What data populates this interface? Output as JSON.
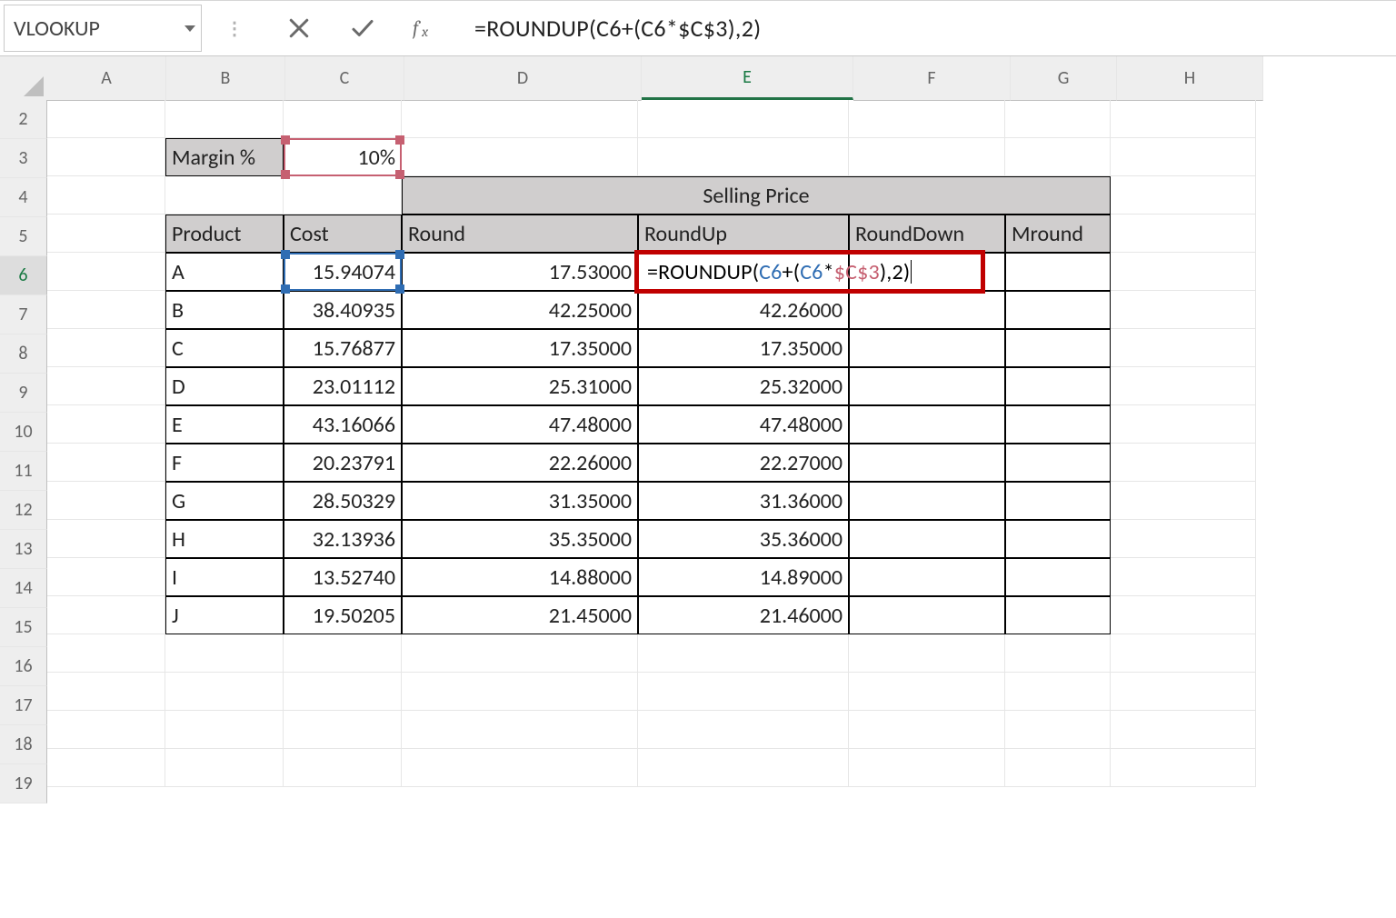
{
  "formula_bar": {
    "name_box": "VLOOKUP",
    "formula": "=ROUNDUP(C6+(C6*$C$3),2)"
  },
  "columns": [
    "A",
    "B",
    "C",
    "D",
    "E",
    "F",
    "G",
    "H"
  ],
  "active_column": "E",
  "row_start": 2,
  "row_end": 19,
  "active_row": 6,
  "margin": {
    "label": "Margin %",
    "value": "10%"
  },
  "section_header": "Selling Price",
  "table_headers": {
    "product": "Product",
    "cost": "Cost",
    "round": "Round",
    "roundup": "RoundUp",
    "rounddown": "RoundDown",
    "mround": "Mround"
  },
  "products": [
    {
      "name": "A",
      "cost": "15.94074",
      "round": "17.53000",
      "roundup": "",
      "rounddown": "",
      "mround": ""
    },
    {
      "name": "B",
      "cost": "38.40935",
      "round": "42.25000",
      "roundup": "42.26000",
      "rounddown": "",
      "mround": ""
    },
    {
      "name": "C",
      "cost": "15.76877",
      "round": "17.35000",
      "roundup": "17.35000",
      "rounddown": "",
      "mround": ""
    },
    {
      "name": "D",
      "cost": "23.01112",
      "round": "25.31000",
      "roundup": "25.32000",
      "rounddown": "",
      "mround": ""
    },
    {
      "name": "E",
      "cost": "43.16066",
      "round": "47.48000",
      "roundup": "47.48000",
      "rounddown": "",
      "mround": ""
    },
    {
      "name": "F",
      "cost": "20.23791",
      "round": "22.26000",
      "roundup": "22.27000",
      "rounddown": "",
      "mround": ""
    },
    {
      "name": "G",
      "cost": "28.50329",
      "round": "31.35000",
      "roundup": "31.36000",
      "rounddown": "",
      "mround": ""
    },
    {
      "name": "H",
      "cost": "32.13936",
      "round": "35.35000",
      "roundup": "35.36000",
      "rounddown": "",
      "mround": ""
    },
    {
      "name": "I",
      "cost": "13.52740",
      "round": "14.88000",
      "roundup": "14.89000",
      "rounddown": "",
      "mround": ""
    },
    {
      "name": "J",
      "cost": "19.50205",
      "round": "21.45000",
      "roundup": "21.46000",
      "rounddown": "",
      "mround": ""
    }
  ],
  "inline_formula": {
    "prefix": "=ROUNDUP(",
    "ref1": "C6",
    "mid1": "+(",
    "ref1b": "C6",
    "mid2": "*",
    "ref2": "$C$3",
    "mid3": ")",
    "suffix": ",2)"
  }
}
